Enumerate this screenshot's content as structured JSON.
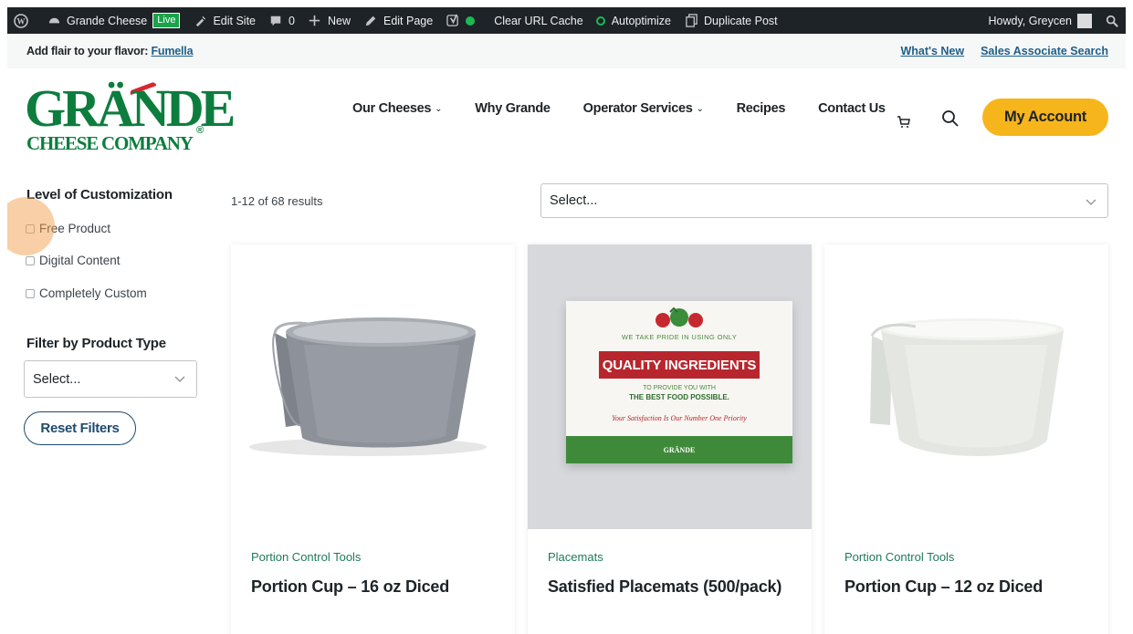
{
  "admin_bar": {
    "site_name": "Grande Cheese",
    "live_badge": "Live",
    "edit_site": "Edit Site",
    "comments_count": "0",
    "new": "New",
    "edit_page": "Edit Page",
    "clear_cache": "Clear URL Cache",
    "autoptimize": "Autoptimize",
    "duplicate_post": "Duplicate Post",
    "howdy": "Howdy, Greycen"
  },
  "promo": {
    "prefix": "Add flair to your flavor:",
    "link": "Fumella",
    "whats_new": "What's New",
    "sales_search": "Sales Associate Search"
  },
  "logo": {
    "main": "GRÄNDE",
    "sub": "CHEESE COMPANY",
    "reg": "®"
  },
  "nav": {
    "items": [
      "Our Cheeses",
      "Why Grande",
      "Operator Services",
      "Recipes",
      "Contact Us"
    ],
    "my_account": "My Account"
  },
  "sidebar": {
    "customization_heading": "Level of Customization",
    "options": [
      "Free Product",
      "Digital Content",
      "Completely Custom"
    ],
    "product_type_heading": "Filter by Product Type",
    "product_type_value": "Select...",
    "reset": "Reset Filters"
  },
  "main": {
    "results_count": "1-12 of 68 results",
    "sort_value": "Select..."
  },
  "products": [
    {
      "category": "Portion Control Tools",
      "title": "Portion Cup – 16 oz Diced"
    },
    {
      "category": "Placemats",
      "title": "Satisfied Placemats (500/pack)"
    },
    {
      "category": "Portion Control Tools",
      "title": "Portion Cup – 12 oz Diced"
    }
  ],
  "placemat": {
    "line1": "WE TAKE PRIDE IN USING ONLY",
    "banner": "QUALITY INGREDIENTS",
    "line2": "TO PROVIDE YOU WITH",
    "line3": "THE BEST FOOD POSSIBLE.",
    "script": "Your Satisfaction Is Our Number One Priority",
    "footer_logo": "GRÄNDE"
  },
  "colors": {
    "brand_green": "#0d7d3e",
    "accent_yellow": "#f7b51c",
    "link_blue": "#1e5f8a",
    "admin_bar": "#1d2327"
  }
}
